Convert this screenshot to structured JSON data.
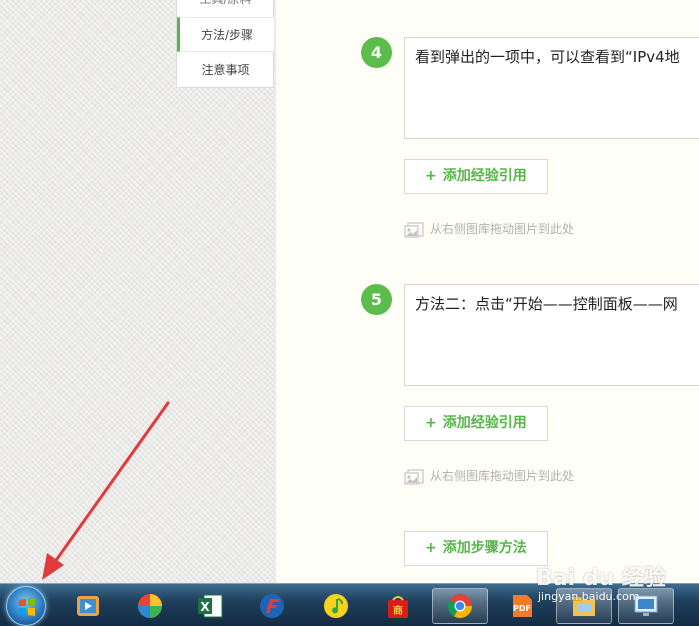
{
  "nav": {
    "items": [
      {
        "label": "工具/原料"
      },
      {
        "label": "方法/步骤"
      },
      {
        "label": "注意事项"
      }
    ]
  },
  "steps": [
    {
      "number": "4",
      "text": "看到弹出的一项中，可以查看到“IPv4地"
    },
    {
      "number": "5",
      "text": "方法二：点击“开始——控制面板——网"
    }
  ],
  "buttons": {
    "add_reference": "添加经验引用",
    "add_step": "添加步骤方法"
  },
  "drop_hint": "从右侧图库拖动图片到此处",
  "watermark": {
    "brand": "Bai du 经验",
    "url": "jingyan.baidu.com"
  },
  "colors": {
    "accent_green": "#5bbd4b",
    "arrow_red": "#e03a3a"
  },
  "taskbar": {
    "icons": [
      "windows-start-icon",
      "media-player-icon",
      "colorful-ball-icon",
      "excel-icon",
      "browser-f-icon",
      "qq-music-icon",
      "shopping-bag-icon",
      "chrome-icon",
      "pdf-icon",
      "file-explorer-icon",
      "network-monitor-icon"
    ]
  }
}
